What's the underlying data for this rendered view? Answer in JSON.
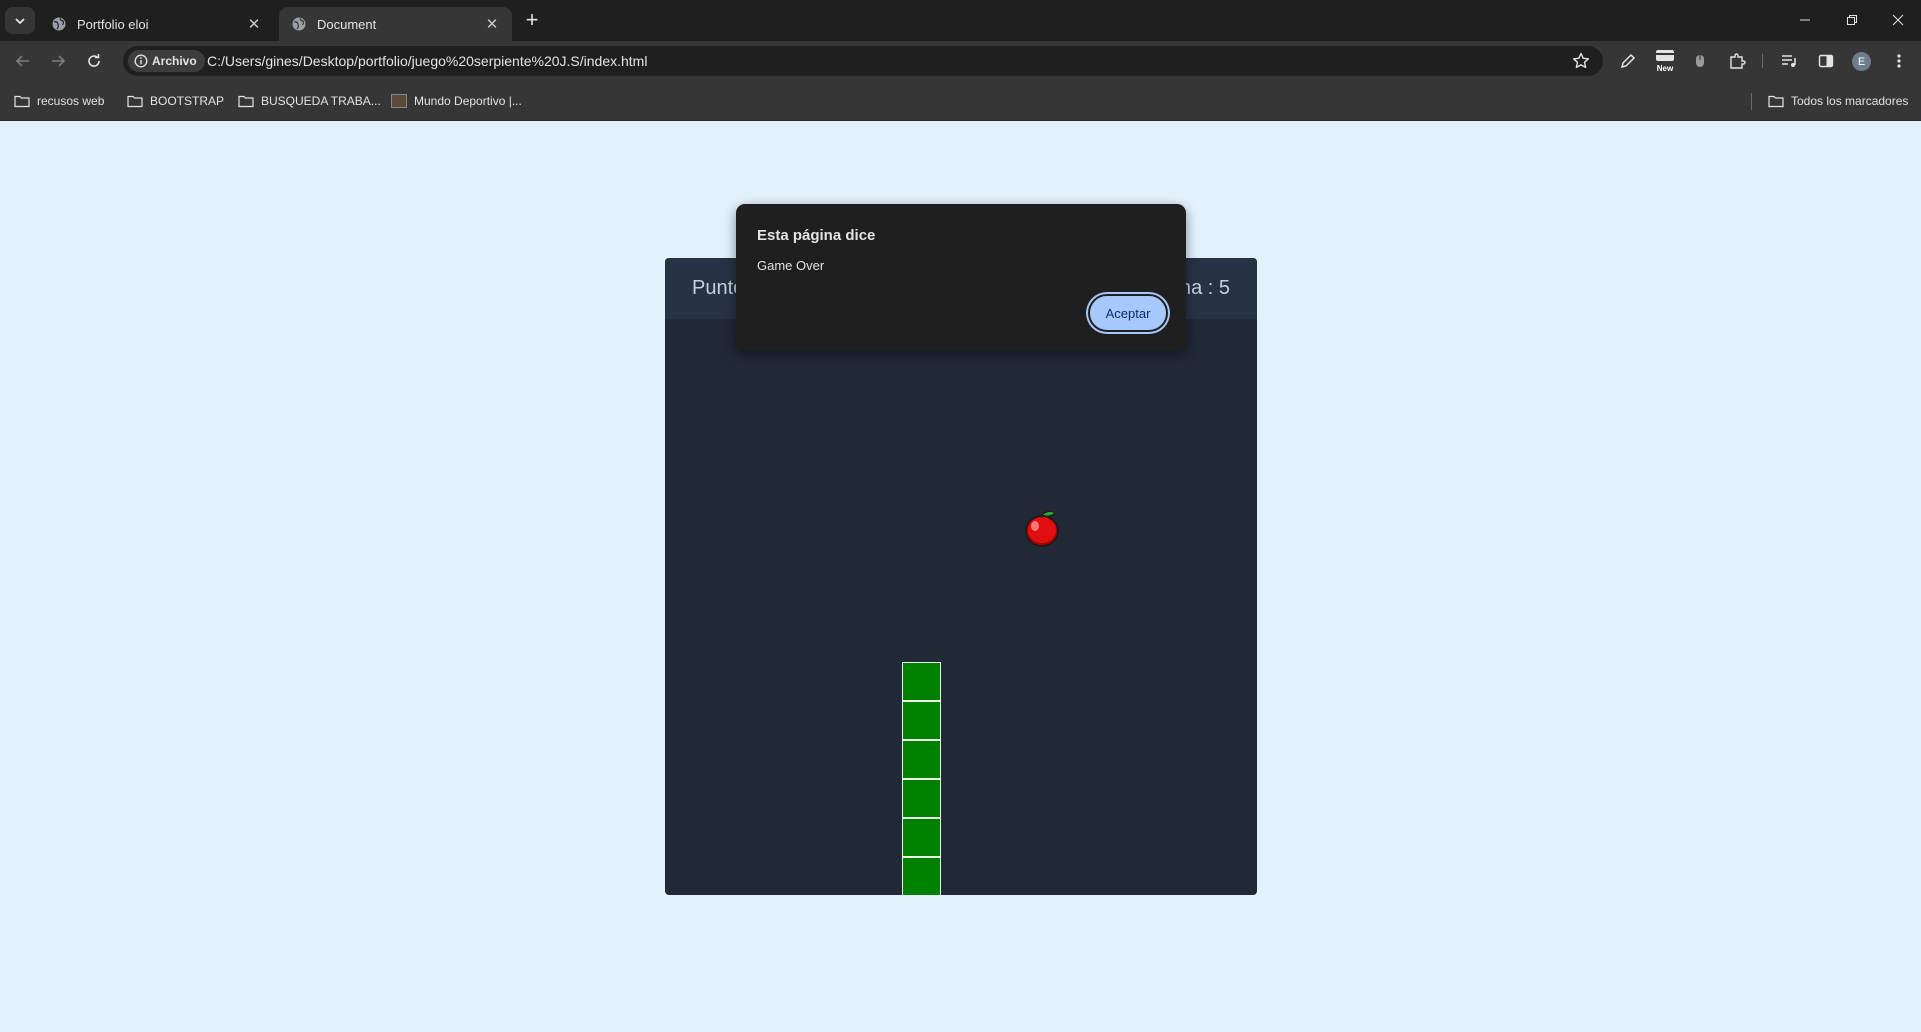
{
  "browser": {
    "tabs": [
      {
        "title": "Portfolio eloi",
        "active": false
      },
      {
        "title": "Document",
        "active": true
      }
    ],
    "address": {
      "chip_label": "Archivo",
      "url": "C:/Users/gines/Desktop/portfolio/juego%20serpiente%20J.S/index.html"
    },
    "toolbar_badge": "New",
    "profile_initial": "E",
    "bookmarks": [
      {
        "label": "recusos web",
        "type": "folder"
      },
      {
        "label": "BOOTSTRAP",
        "type": "folder"
      },
      {
        "label": "BUSQUEDA TRABA...",
        "type": "folder"
      },
      {
        "label": "Mundo Deportivo |...",
        "type": "site"
      }
    ],
    "all_bookmarks_label": "Todos los marcadores"
  },
  "dialog": {
    "title": "Esta página dice",
    "message": "Game Over",
    "ok_label": "Aceptar"
  },
  "game": {
    "score_label": "Puntos : 5",
    "high_score_label": "Puntuacion maxima : 5",
    "score": 5,
    "high_score": 5,
    "snake_color": "#008000",
    "board_color": "#212836",
    "food_icon": "apple-icon"
  }
}
